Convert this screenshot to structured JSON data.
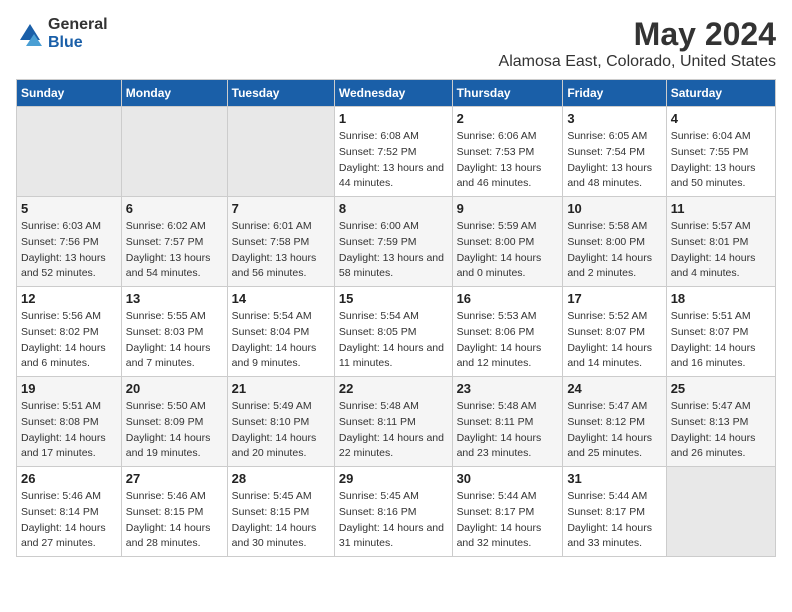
{
  "logo": {
    "general": "General",
    "blue": "Blue"
  },
  "title": "May 2024",
  "subtitle": "Alamosa East, Colorado, United States",
  "days_of_week": [
    "Sunday",
    "Monday",
    "Tuesday",
    "Wednesday",
    "Thursday",
    "Friday",
    "Saturday"
  ],
  "weeks": [
    [
      {
        "day": "",
        "empty": true
      },
      {
        "day": "",
        "empty": true
      },
      {
        "day": "",
        "empty": true
      },
      {
        "day": "1",
        "sunrise": "6:08 AM",
        "sunset": "7:52 PM",
        "daylight": "13 hours and 44 minutes."
      },
      {
        "day": "2",
        "sunrise": "6:06 AM",
        "sunset": "7:53 PM",
        "daylight": "13 hours and 46 minutes."
      },
      {
        "day": "3",
        "sunrise": "6:05 AM",
        "sunset": "7:54 PM",
        "daylight": "13 hours and 48 minutes."
      },
      {
        "day": "4",
        "sunrise": "6:04 AM",
        "sunset": "7:55 PM",
        "daylight": "13 hours and 50 minutes."
      }
    ],
    [
      {
        "day": "5",
        "sunrise": "6:03 AM",
        "sunset": "7:56 PM",
        "daylight": "13 hours and 52 minutes."
      },
      {
        "day": "6",
        "sunrise": "6:02 AM",
        "sunset": "7:57 PM",
        "daylight": "13 hours and 54 minutes."
      },
      {
        "day": "7",
        "sunrise": "6:01 AM",
        "sunset": "7:58 PM",
        "daylight": "13 hours and 56 minutes."
      },
      {
        "day": "8",
        "sunrise": "6:00 AM",
        "sunset": "7:59 PM",
        "daylight": "13 hours and 58 minutes."
      },
      {
        "day": "9",
        "sunrise": "5:59 AM",
        "sunset": "8:00 PM",
        "daylight": "14 hours and 0 minutes."
      },
      {
        "day": "10",
        "sunrise": "5:58 AM",
        "sunset": "8:00 PM",
        "daylight": "14 hours and 2 minutes."
      },
      {
        "day": "11",
        "sunrise": "5:57 AM",
        "sunset": "8:01 PM",
        "daylight": "14 hours and 4 minutes."
      }
    ],
    [
      {
        "day": "12",
        "sunrise": "5:56 AM",
        "sunset": "8:02 PM",
        "daylight": "14 hours and 6 minutes."
      },
      {
        "day": "13",
        "sunrise": "5:55 AM",
        "sunset": "8:03 PM",
        "daylight": "14 hours and 7 minutes."
      },
      {
        "day": "14",
        "sunrise": "5:54 AM",
        "sunset": "8:04 PM",
        "daylight": "14 hours and 9 minutes."
      },
      {
        "day": "15",
        "sunrise": "5:54 AM",
        "sunset": "8:05 PM",
        "daylight": "14 hours and 11 minutes."
      },
      {
        "day": "16",
        "sunrise": "5:53 AM",
        "sunset": "8:06 PM",
        "daylight": "14 hours and 12 minutes."
      },
      {
        "day": "17",
        "sunrise": "5:52 AM",
        "sunset": "8:07 PM",
        "daylight": "14 hours and 14 minutes."
      },
      {
        "day": "18",
        "sunrise": "5:51 AM",
        "sunset": "8:07 PM",
        "daylight": "14 hours and 16 minutes."
      }
    ],
    [
      {
        "day": "19",
        "sunrise": "5:51 AM",
        "sunset": "8:08 PM",
        "daylight": "14 hours and 17 minutes."
      },
      {
        "day": "20",
        "sunrise": "5:50 AM",
        "sunset": "8:09 PM",
        "daylight": "14 hours and 19 minutes."
      },
      {
        "day": "21",
        "sunrise": "5:49 AM",
        "sunset": "8:10 PM",
        "daylight": "14 hours and 20 minutes."
      },
      {
        "day": "22",
        "sunrise": "5:48 AM",
        "sunset": "8:11 PM",
        "daylight": "14 hours and 22 minutes."
      },
      {
        "day": "23",
        "sunrise": "5:48 AM",
        "sunset": "8:11 PM",
        "daylight": "14 hours and 23 minutes."
      },
      {
        "day": "24",
        "sunrise": "5:47 AM",
        "sunset": "8:12 PM",
        "daylight": "14 hours and 25 minutes."
      },
      {
        "day": "25",
        "sunrise": "5:47 AM",
        "sunset": "8:13 PM",
        "daylight": "14 hours and 26 minutes."
      }
    ],
    [
      {
        "day": "26",
        "sunrise": "5:46 AM",
        "sunset": "8:14 PM",
        "daylight": "14 hours and 27 minutes."
      },
      {
        "day": "27",
        "sunrise": "5:46 AM",
        "sunset": "8:15 PM",
        "daylight": "14 hours and 28 minutes."
      },
      {
        "day": "28",
        "sunrise": "5:45 AM",
        "sunset": "8:15 PM",
        "daylight": "14 hours and 30 minutes."
      },
      {
        "day": "29",
        "sunrise": "5:45 AM",
        "sunset": "8:16 PM",
        "daylight": "14 hours and 31 minutes."
      },
      {
        "day": "30",
        "sunrise": "5:44 AM",
        "sunset": "8:17 PM",
        "daylight": "14 hours and 32 minutes."
      },
      {
        "day": "31",
        "sunrise": "5:44 AM",
        "sunset": "8:17 PM",
        "daylight": "14 hours and 33 minutes."
      },
      {
        "day": "",
        "empty": true
      }
    ]
  ],
  "labels": {
    "sunrise_prefix": "Sunrise: ",
    "sunset_prefix": "Sunset: ",
    "daylight_prefix": "Daylight: "
  }
}
